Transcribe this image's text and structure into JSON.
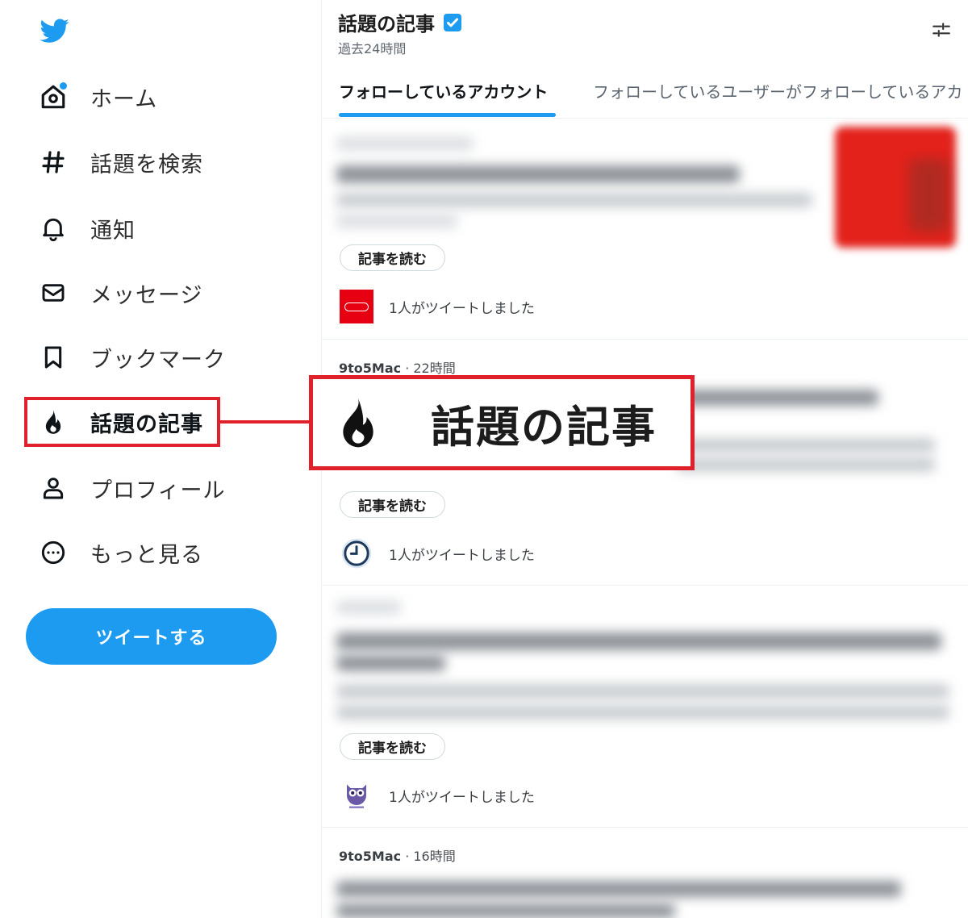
{
  "colors": {
    "accent": "#1d9bf0",
    "highlight": "#e0202a",
    "nintendo": "#e60012"
  },
  "sidebar": {
    "logo_icon": "twitter-bird-icon",
    "items": [
      {
        "label": "ホーム",
        "icon": "home-icon"
      },
      {
        "label": "話題を検索",
        "icon": "hashtag-icon"
      },
      {
        "label": "通知",
        "icon": "bell-icon"
      },
      {
        "label": "メッセージ",
        "icon": "envelope-icon"
      },
      {
        "label": "ブックマーク",
        "icon": "bookmark-icon"
      },
      {
        "label": "話題の記事",
        "icon": "flame-icon"
      },
      {
        "label": "プロフィール",
        "icon": "person-icon"
      },
      {
        "label": "もっと見る",
        "icon": "more-circle-icon"
      }
    ],
    "tweet_button": "ツイートする"
  },
  "callout": {
    "label": "話題の記事",
    "icon": "flame-icon"
  },
  "header": {
    "title": "話題の記事",
    "subtitle": "過去24時間",
    "settings_icon": "sliders-icon"
  },
  "tabs": [
    {
      "label": "フォローしているアカウント",
      "active": true
    },
    {
      "label": "フォローしているユーザーがフォローしているアカ",
      "active": false
    }
  ],
  "articles": [
    {
      "read_label": "記事を読む",
      "tweeted_text": "1人がツイートしました",
      "avatar": "nintendo-logo"
    },
    {
      "source": "9to5Mac",
      "time": "· 22時間",
      "read_label": "記事を読む",
      "tweeted_text": "1人がツイートしました",
      "avatar": "clock-icon"
    },
    {
      "read_label": "記事を読む",
      "tweeted_text": "1人がツイートしました",
      "avatar": "owl-icon"
    },
    {
      "source": "9to5Mac",
      "time": "· 16時間"
    }
  ]
}
